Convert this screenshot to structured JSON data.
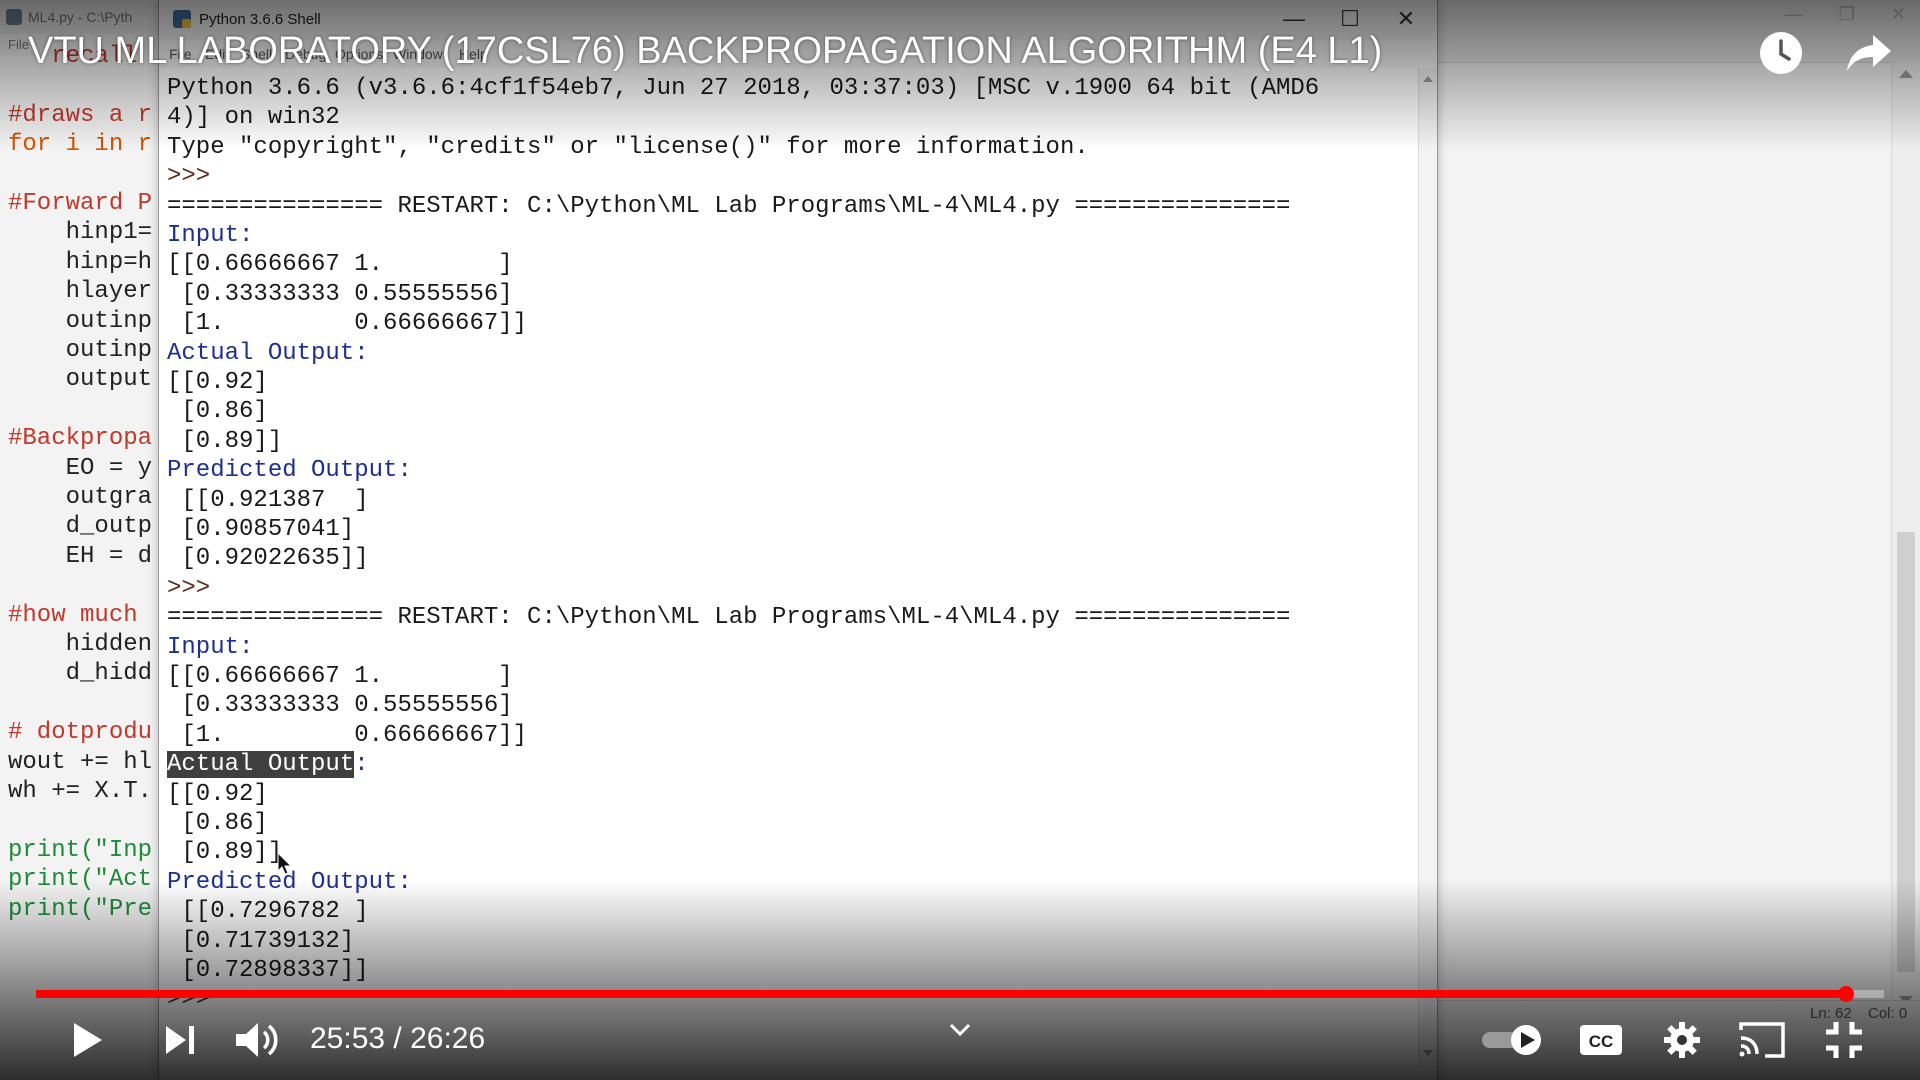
{
  "editor": {
    "title": "ML4.py - C:\\Pyth",
    "menu": "File",
    "lines": [
      {
        "text": "   recall",
        "cls": "c-comment"
      },
      {
        "text": "",
        "cls": "c-normal"
      },
      {
        "text": "#draws a r",
        "cls": "c-comment"
      },
      {
        "text": "for i in r",
        "cls": "c-keyword"
      },
      {
        "text": "",
        "cls": "c-normal"
      },
      {
        "text": "#Forward P",
        "cls": "c-comment"
      },
      {
        "text": "    hinp1=",
        "cls": "c-normal"
      },
      {
        "text": "    hinp=h",
        "cls": "c-normal"
      },
      {
        "text": "    hlayer",
        "cls": "c-normal"
      },
      {
        "text": "    outinp",
        "cls": "c-normal"
      },
      {
        "text": "    outinp",
        "cls": "c-normal"
      },
      {
        "text": "    output",
        "cls": "c-normal"
      },
      {
        "text": "",
        "cls": "c-normal"
      },
      {
        "text": "#Backpropa",
        "cls": "c-comment"
      },
      {
        "text": "    EO = y",
        "cls": "c-normal"
      },
      {
        "text": "    outgra",
        "cls": "c-normal"
      },
      {
        "text": "    d_outp",
        "cls": "c-normal"
      },
      {
        "text": "    EH = d",
        "cls": "c-normal"
      },
      {
        "text": "",
        "cls": "c-normal"
      },
      {
        "text": "#how much",
        "cls": "c-comment"
      },
      {
        "text": "    hidden",
        "cls": "c-normal"
      },
      {
        "text": "    d_hidd",
        "cls": "c-normal"
      },
      {
        "text": "",
        "cls": "c-normal"
      },
      {
        "text": "# dotprodu",
        "cls": "c-comment"
      },
      {
        "text": "wout += hl",
        "cls": "c-normal"
      },
      {
        "text": "wh += X.T.",
        "cls": "c-normal"
      },
      {
        "text": "",
        "cls": "c-normal"
      },
      {
        "text": "print(\"Inp",
        "cls": "c-string"
      },
      {
        "text": "print(\"Act",
        "cls": "c-string"
      },
      {
        "text": "print(\"Pre",
        "cls": "c-string"
      }
    ]
  },
  "shell": {
    "title": "Python 3.6.6 Shell",
    "menus": [
      "File",
      "Edit",
      "Shell",
      "Debug",
      "Options",
      "Window",
      "Help"
    ],
    "lines": [
      "Python 3.6.6 (v3.6.6:4cf1f54eb7, Jun 27 2018, 03:37:03) [MSC v.1900 64 bit (AMD6",
      "4)] on win32",
      "Type \"copyright\", \"credits\" or \"license()\" for more information.",
      ">>>",
      "=============== RESTART: C:\\Python\\ML Lab Programs\\ML-4\\ML4.py ===============",
      "Input:",
      "[[0.66666667 1.        ]",
      " [0.33333333 0.55555556]",
      " [1.         0.66666667]]",
      "Actual Output:",
      "[[0.92]",
      " [0.86]",
      " [0.89]]",
      "Predicted Output:",
      " [[0.921387  ]",
      " [0.90857041]",
      " [0.92022635]]",
      ">>>",
      "=============== RESTART: C:\\Python\\ML Lab Programs\\ML-4\\ML4.py ===============",
      "Input:",
      "[[0.66666667 1.        ]",
      " [0.33333333 0.55555556]",
      " [1.         0.66666667]]",
      "Actual Output:",
      "[[0.92]",
      " [0.86]",
      " [0.89]]",
      "Predicted Output:",
      " [[0.7296782 ]",
      " [0.71739132]",
      " [0.72898337]]",
      ">>>"
    ],
    "highlighted_text": "Actual Output",
    "highlighted_suffix": ":"
  },
  "status": {
    "ln": "Ln: 62",
    "col": "Col: 0"
  },
  "video": {
    "title": "VTU ML LABORATORY (17CSL76) BACKPROPAGATION ALGORITHM (E4 L1)",
    "time_current": "25:53",
    "time_sep": " / ",
    "time_total": "26:26",
    "progress_fraction": 0.9792,
    "icons": {
      "play": "play-icon",
      "next": "next-icon",
      "volume": "volume-icon",
      "watch_later": "clock-icon",
      "share": "share-icon",
      "autoplay": "autoplay-toggle-icon",
      "captions": "cc-icon",
      "settings": "gear-icon",
      "cast": "cast-icon",
      "fullscreen_exit": "exit-fullscreen-icon",
      "chevron": "chevron-down-icon"
    },
    "colors": {
      "progress": "#ff0000",
      "text": "#ffffff"
    }
  }
}
